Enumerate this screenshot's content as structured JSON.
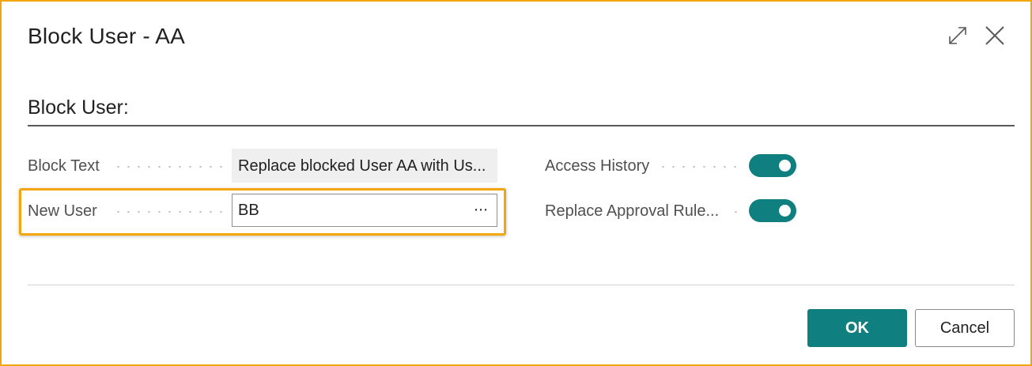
{
  "dialog": {
    "title": "Block User - AA",
    "expand_icon": "expand-icon",
    "close_icon": "close-icon"
  },
  "section": {
    "title": "Block User:"
  },
  "fields": {
    "block_text": {
      "label": "Block Text",
      "value": "Replace blocked User AA with Us..."
    },
    "new_user": {
      "label": "New User",
      "value": "BB",
      "lookup_icon": "ellipsis-icon",
      "lookup_glyph": "⋯"
    },
    "access_history": {
      "label": "Access History",
      "on": true
    },
    "replace_approval_rules": {
      "label": "Replace Approval Rule...",
      "on": true
    }
  },
  "footer": {
    "ok_label": "OK",
    "cancel_label": "Cancel"
  },
  "colors": {
    "accent": "#0f7f7f",
    "highlight": "#f2a60c"
  }
}
